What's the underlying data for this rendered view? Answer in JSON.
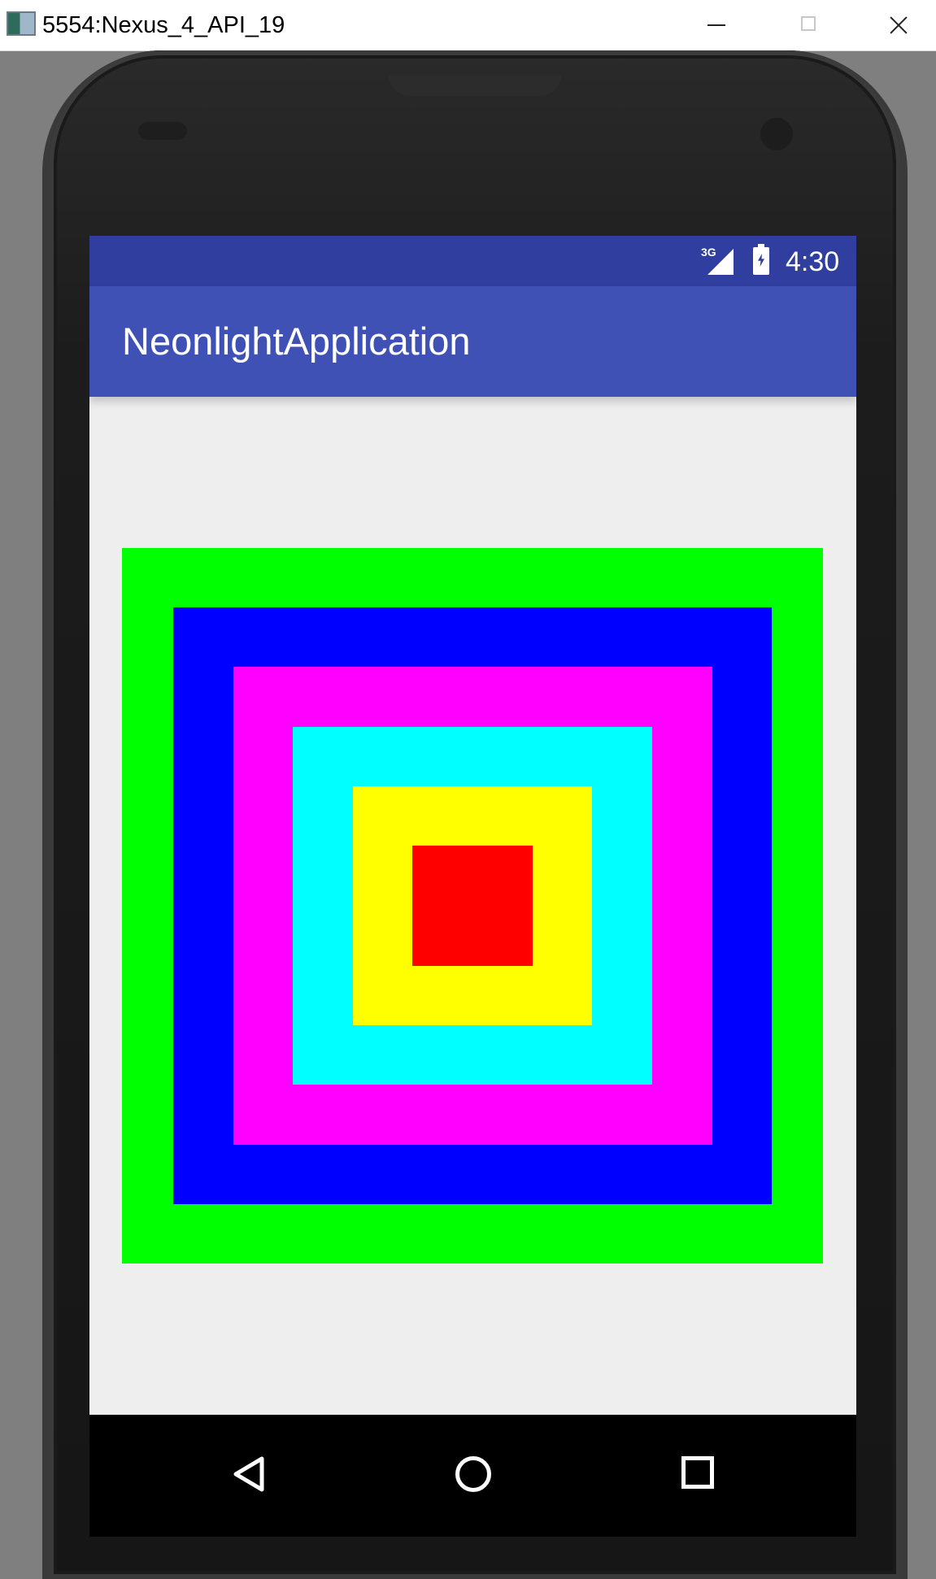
{
  "window": {
    "title": "5554:Nexus_4_API_19",
    "icons": [
      "app-icon",
      "minimize-icon",
      "maximize-icon",
      "close-icon"
    ]
  },
  "status_bar": {
    "network_type": "3G",
    "time": "4:30",
    "icons": [
      "signal-icon",
      "battery-charging-icon"
    ]
  },
  "app_bar": {
    "title": "NeonlightApplication"
  },
  "content": {
    "nested_squares": [
      {
        "name": "outer-square",
        "color": "#00ff00"
      },
      {
        "name": "second-square",
        "color": "#0000ff"
      },
      {
        "name": "third-square",
        "color": "#ff00ff"
      },
      {
        "name": "fourth-square",
        "color": "#00ffff"
      },
      {
        "name": "fifth-square",
        "color": "#ffff00"
      },
      {
        "name": "inner-square",
        "color": "#ff0000"
      }
    ]
  },
  "nav_bar": {
    "icons": [
      "back-icon",
      "home-icon",
      "recents-icon"
    ]
  },
  "colors": {
    "status_bar": "#303f9f",
    "app_bar": "#3f51b5",
    "screen_background": "#eeeeee"
  }
}
